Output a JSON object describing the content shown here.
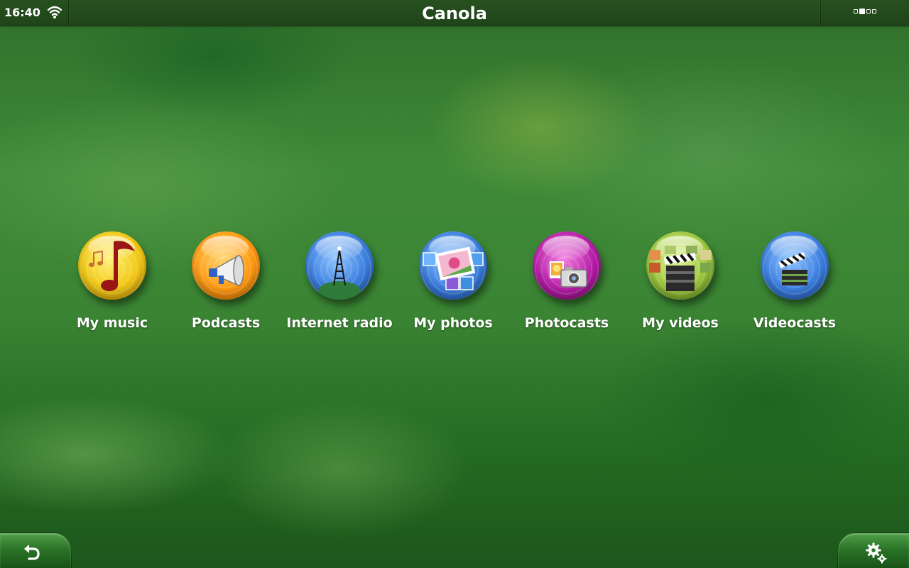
{
  "status_bar": {
    "time": "16:40",
    "wifi_icon": "wifi-icon",
    "title": "Canola",
    "pager": {
      "pages": 3,
      "active_page": 2
    }
  },
  "launcher": {
    "items": [
      {
        "label": "My music",
        "icon": "music-note-icon",
        "color": "#f2c814"
      },
      {
        "label": "Podcasts",
        "icon": "megaphone-icon",
        "color": "#ff9a12"
      },
      {
        "label": "Internet radio",
        "icon": "radio-tower-icon",
        "color": "#3c7fe0"
      },
      {
        "label": "My photos",
        "icon": "photos-icon",
        "color": "#3c7fe0"
      },
      {
        "label": "Photocasts",
        "icon": "camera-icon",
        "color": "#b81da8"
      },
      {
        "label": "My videos",
        "icon": "clapperboard-film-icon",
        "color": "#9cc73b"
      },
      {
        "label": "Videocasts",
        "icon": "clapperboard-icon",
        "color": "#3c7fe0"
      }
    ]
  },
  "bottom_bar": {
    "back_icon": "back-arrow-icon",
    "settings_icon": "gear-icon"
  }
}
